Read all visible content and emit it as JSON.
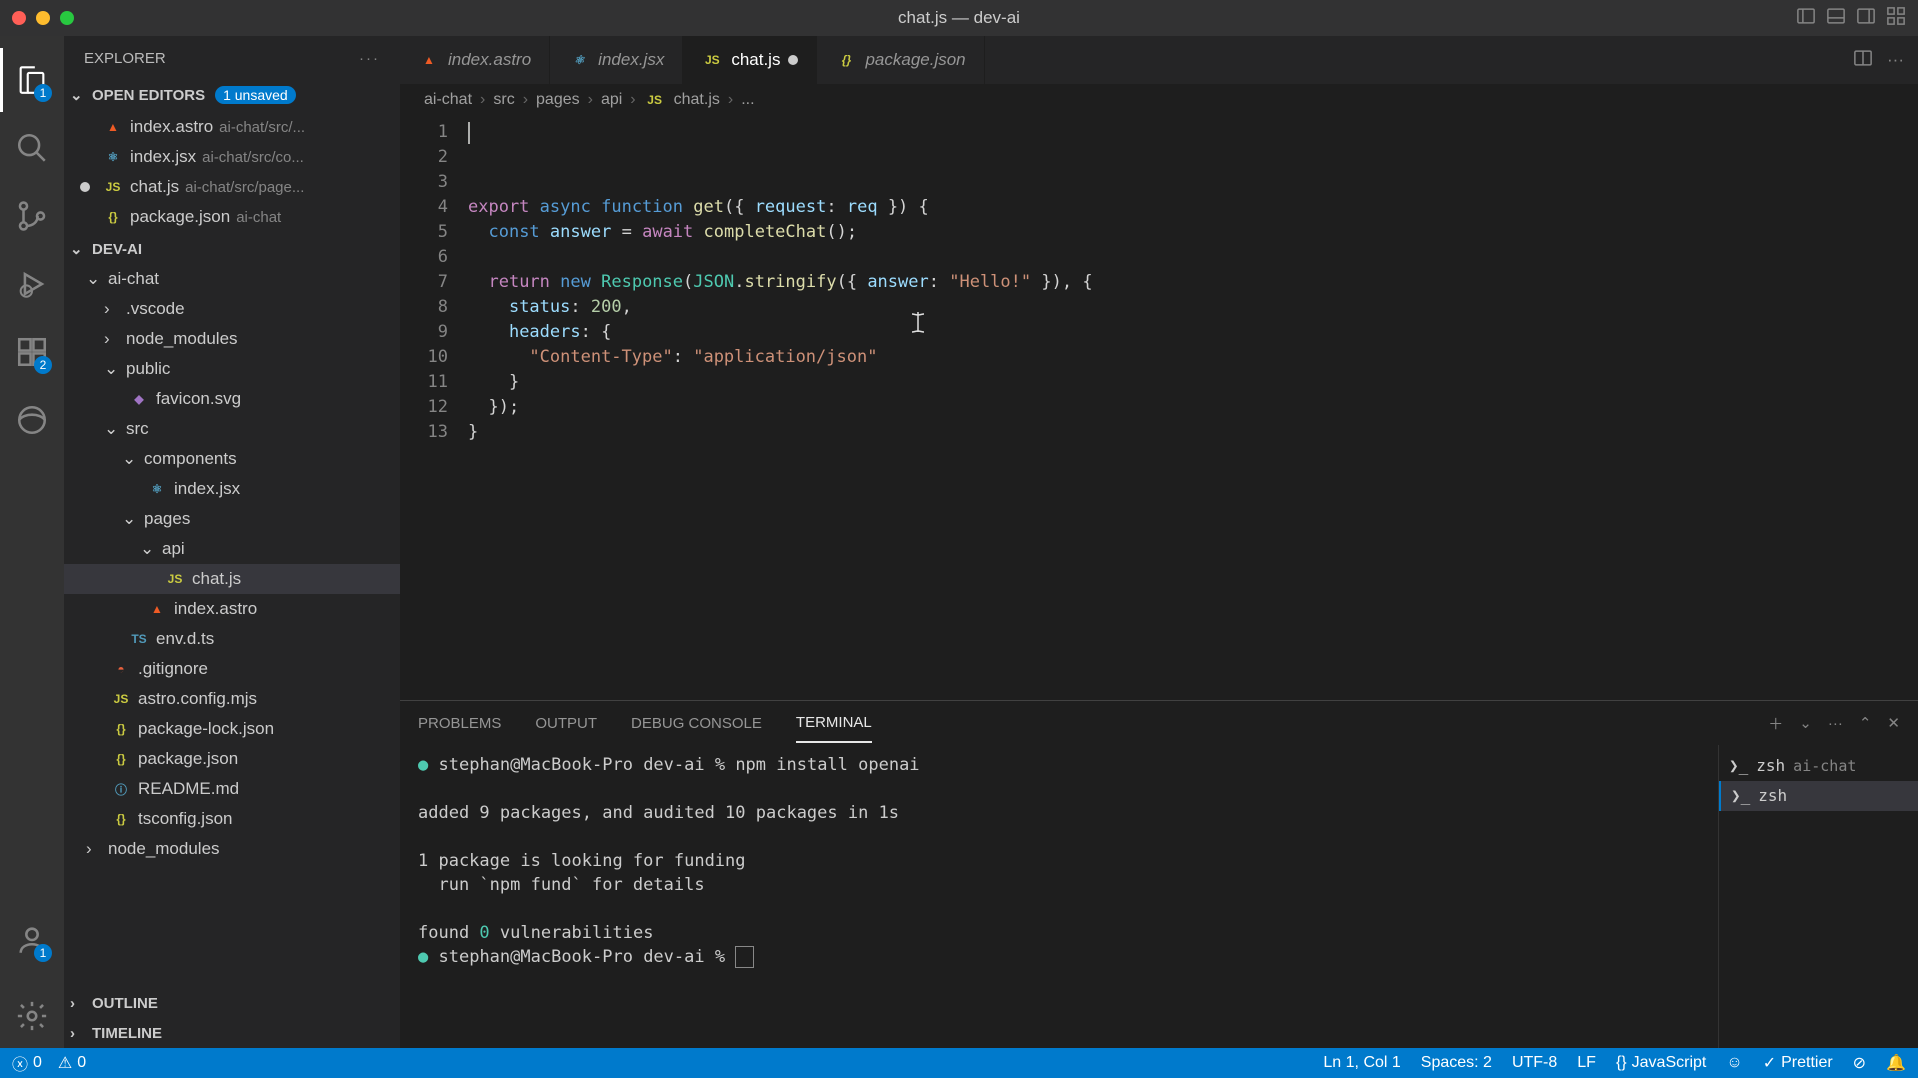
{
  "window": {
    "title": "chat.js — dev-ai"
  },
  "sidebar": {
    "title": "EXPLORER",
    "openEditorsLabel": "OPEN EDITORS",
    "unsavedBadge": "1 unsaved",
    "projectLabel": "DEV-AI",
    "outlineLabel": "OUTLINE",
    "timelineLabel": "TIMELINE",
    "openEditors": [
      {
        "name": "index.astro",
        "hint": "ai-chat/src/..."
      },
      {
        "name": "index.jsx",
        "hint": "ai-chat/src/co..."
      },
      {
        "name": "chat.js",
        "hint": "ai-chat/src/page...",
        "dirty": true
      },
      {
        "name": "package.json",
        "hint": "ai-chat"
      }
    ],
    "tree": {
      "root": "ai-chat",
      "vscode": ".vscode",
      "node_modules": "node_modules",
      "public": "public",
      "favicon": "favicon.svg",
      "src": "src",
      "components": "components",
      "index_jsx": "index.jsx",
      "pages": "pages",
      "api": "api",
      "chat_js": "chat.js",
      "index_astro": "index.astro",
      "env_d_ts": "env.d.ts",
      "gitignore": ".gitignore",
      "astro_config": "astro.config.mjs",
      "pkg_lock": "package-lock.json",
      "pkg": "package.json",
      "readme": "README.md",
      "tsconfig": "tsconfig.json",
      "node_modules2": "node_modules"
    }
  },
  "tabs": [
    {
      "name": "index.astro"
    },
    {
      "name": "index.jsx"
    },
    {
      "name": "chat.js",
      "active": true,
      "dirty": true
    },
    {
      "name": "package.json"
    }
  ],
  "breadcrumb": [
    "ai-chat",
    "src",
    "pages",
    "api",
    "chat.js",
    "..."
  ],
  "code": {
    "lines": 13
  },
  "panel": {
    "tabs": {
      "problems": "PROBLEMS",
      "output": "OUTPUT",
      "debug": "DEBUG CONSOLE",
      "terminal": "TERMINAL"
    },
    "terminal": {
      "line1_prompt": "stephan@MacBook-Pro dev-ai % ",
      "line1_cmd": "npm install openai",
      "line2": "added 9 packages, and audited 10 packages in 1s",
      "line3": "1 package is looking for funding",
      "line4": "  run `npm fund` for details",
      "line5a": "found ",
      "line5b": "0",
      "line5c": " vulnerabilities",
      "line6": "stephan@MacBook-Pro dev-ai % "
    },
    "termList": {
      "t1": "zsh",
      "t1hint": "ai-chat",
      "t2": "zsh"
    }
  },
  "status": {
    "errors": "0",
    "warnings": "0",
    "lncol": "Ln 1, Col 1",
    "spaces": "Spaces: 2",
    "encoding": "UTF-8",
    "eol": "LF",
    "lang": "JavaScript",
    "prettier": "Prettier"
  }
}
